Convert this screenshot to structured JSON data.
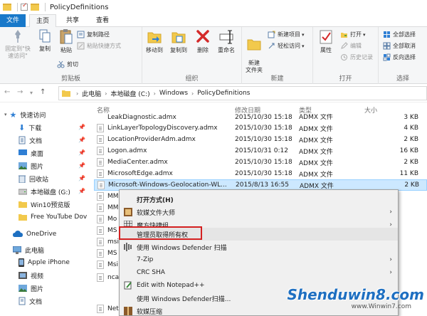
{
  "window": {
    "title": "PolicyDefinitions"
  },
  "tabs": {
    "file": "文件",
    "home": "主页",
    "share": "共享",
    "view": "查看"
  },
  "ribbon": {
    "clipboard": {
      "label": "剪贴板",
      "pin": "固定到\"快速访问\"",
      "copy": "复制",
      "paste": "粘贴",
      "copy_path": "复制路径",
      "paste_shortcut": "粘贴快捷方式",
      "cut": "剪切"
    },
    "organize": {
      "label": "组织",
      "move_to": "移动到",
      "copy_to": "复制到",
      "delete": "删除",
      "rename": "重命名"
    },
    "new": {
      "label": "新建",
      "new_folder": "新建\n文件夹",
      "new_item": "新建项目",
      "easy_access": "轻松访问"
    },
    "open": {
      "label": "打开",
      "properties": "属性",
      "open": "打开",
      "edit": "编辑",
      "history": "历史记录"
    },
    "select": {
      "label": "选择",
      "select_all": "全部选择",
      "select_none": "全部取消",
      "invert": "反向选择"
    }
  },
  "address": {
    "crumbs": [
      "此电脑",
      "本地磁盘 (C:)",
      "Windows",
      "PolicyDefinitions"
    ]
  },
  "nav": {
    "items": [
      {
        "label": "快速访问"
      },
      {
        "label": "下载"
      },
      {
        "label": "文档"
      },
      {
        "label": "桌面"
      },
      {
        "label": "图片"
      },
      {
        "label": "回收站"
      },
      {
        "label": "本地磁盘 (G:)"
      },
      {
        "label": "Win10预览版"
      },
      {
        "label": "Free YouTube Dov"
      },
      {
        "label": "OneDrive"
      },
      {
        "label": "此电脑"
      },
      {
        "label": "Apple iPhone"
      },
      {
        "label": "视频"
      },
      {
        "label": "图片"
      },
      {
        "label": "文档"
      }
    ]
  },
  "columns": {
    "name": "名称",
    "date": "修改日期",
    "type": "类型",
    "size": "大小"
  },
  "files": [
    {
      "name": "LeakDiagnostic.admx",
      "date": "2015/10/30 15:18",
      "type": "ADMX 文件",
      "size": "3 KB"
    },
    {
      "name": "LinkLayerTopologyDiscovery.admx",
      "date": "2015/10/30 15:18",
      "type": "ADMX 文件",
      "size": "4 KB"
    },
    {
      "name": "LocationProviderAdm.admx",
      "date": "2015/10/30 15:18",
      "type": "ADMX 文件",
      "size": "2 KB"
    },
    {
      "name": "Logon.admx",
      "date": "2015/10/31 0:12",
      "type": "ADMX 文件",
      "size": "16 KB"
    },
    {
      "name": "MediaCenter.admx",
      "date": "2015/10/30 15:18",
      "type": "ADMX 文件",
      "size": "2 KB"
    },
    {
      "name": "MicrosoftEdge.admx",
      "date": "2015/10/30 15:18",
      "type": "ADMX 文件",
      "size": "11 KB"
    },
    {
      "name": "Microsoft-Windows-Geolocation-WL...",
      "date": "2015/8/13 16:55",
      "type": "ADMX 文件",
      "size": "2 KB"
    },
    {
      "name": "MM",
      "date": "",
      "type": "",
      "size": ""
    },
    {
      "name": "MM",
      "date": "",
      "type": "",
      "size": ""
    },
    {
      "name": "Mo",
      "date": "",
      "type": "",
      "size": ""
    },
    {
      "name": "MS",
      "date": "",
      "type": "",
      "size": ""
    },
    {
      "name": "msi",
      "date": "",
      "type": "",
      "size": ""
    },
    {
      "name": "MS",
      "date": "",
      "type": "",
      "size": ""
    },
    {
      "name": "Msi",
      "date": "",
      "type": "",
      "size": ""
    },
    {
      "name": "nca",
      "date": "",
      "type": "",
      "size": ""
    },
    {
      "name": "Net",
      "date": "",
      "type": "",
      "size": ""
    }
  ],
  "context_menu": {
    "items": [
      {
        "label": "打开方式(H)"
      },
      {
        "label": "软媒文件大师"
      },
      {
        "label": "魔方快捷组"
      },
      {
        "label": "管理员取得所有权"
      },
      {
        "label": "使用 Windows Defender 扫描"
      },
      {
        "label": "7-Zip"
      },
      {
        "label": "CRC SHA"
      },
      {
        "label": "Edit with Notepad++"
      },
      {
        "label": "使用 Windows Defender扫描..."
      },
      {
        "label": "软媒压缩"
      }
    ]
  },
  "watermark": {
    "main": "Shenduwin8.com",
    "sub": "www.Winwin7.com"
  },
  "colors": {
    "accent": "#1979ca",
    "selection": "#cce8ff",
    "highlight_box": "#d42020"
  }
}
